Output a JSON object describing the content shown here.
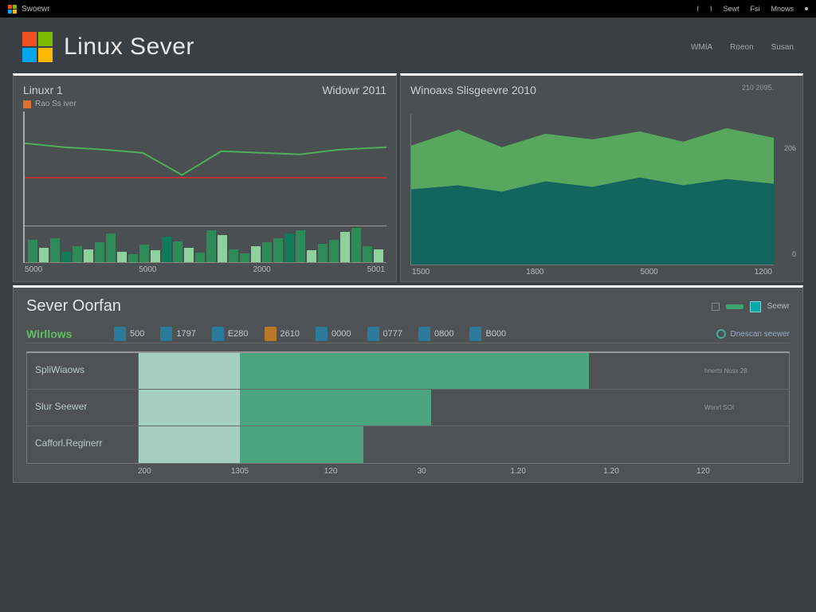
{
  "topbar": {
    "app_label": "Swoewr",
    "nav": [
      "I",
      "I",
      "Sewt",
      "Fsi",
      "Mnows",
      "I"
    ]
  },
  "header": {
    "title": "Linux Sever",
    "nav": [
      "WMIA",
      "Roeon",
      "Susan"
    ]
  },
  "panel_left": {
    "title_left": "Linuxr 1",
    "title_right": "Widowr 2011",
    "legend_label": "Rao Ss iver",
    "legend_color": "#e07030",
    "xaxis": [
      "5000",
      "5000",
      "2000",
      "5001"
    ]
  },
  "panel_right": {
    "title": "Winoaxs Slisgeevre 2010",
    "side_label_top": "206",
    "side_label_bottom": "0",
    "right_meta": [
      "210",
      "2095."
    ],
    "xaxis": [
      "1500",
      "1800",
      "5000",
      "1200"
    ]
  },
  "section": {
    "title": "Sever Oorfan",
    "toggle_label": "Seewr",
    "stat_label": "Wirllows",
    "stats": [
      "500",
      "1797",
      "E280",
      "2610",
      "0000",
      "0777",
      "0800",
      "B000"
    ],
    "end_label": "Dnescan seewer",
    "hbars": {
      "rows": [
        {
          "label": "SpliWiaows",
          "note": "hnerts Nosx 28"
        },
        {
          "label": "Slur Seewer",
          "note": "Wonrt SOI"
        },
        {
          "label": "Cafforl.Reginerr",
          "note": ""
        }
      ],
      "xaxis": [
        "200",
        "1305",
        "120",
        "30",
        "1.20",
        "1.20",
        "120"
      ]
    }
  },
  "chart_data": [
    {
      "type": "line",
      "title": "Linuxr 1 / Widowr 2011",
      "x": [
        0,
        1,
        2,
        3,
        4,
        5,
        6,
        7,
        8,
        9
      ],
      "series": [
        {
          "name": "green-line",
          "values": [
            150,
            145,
            142,
            138,
            110,
            140,
            138,
            136,
            142,
            145
          ]
        },
        {
          "name": "red-line",
          "values": [
            105,
            105,
            105,
            105,
            105,
            105,
            105,
            105,
            105,
            105
          ]
        }
      ],
      "bars": {
        "values": [
          28,
          18,
          30,
          12,
          20,
          16,
          25,
          36,
          14,
          10,
          22,
          15,
          32,
          26,
          18,
          12,
          40,
          34,
          16,
          11,
          20,
          25,
          30,
          36,
          40,
          15,
          24,
          28,
          38,
          44,
          20,
          16
        ]
      },
      "ylim": [
        0,
        190
      ]
    },
    {
      "type": "area",
      "title": "Winoaxs Slisgeevre 2010",
      "x": [
        0,
        1,
        2,
        3,
        4,
        5,
        6,
        7,
        8
      ],
      "series": [
        {
          "name": "dark",
          "values": [
            95,
            100,
            92,
            105,
            98,
            110,
            100,
            108,
            102
          ]
        },
        {
          "name": "light",
          "values": [
            150,
            170,
            148,
            165,
            158,
            168,
            155,
            172,
            160
          ]
        }
      ],
      "ylim": [
        0,
        206
      ]
    },
    {
      "type": "bar",
      "title": "Sever Oorfan",
      "orientation": "horizontal",
      "categories": [
        "SpliWiaows",
        "Slur Seewer",
        "Cafforl.Reginerr"
      ],
      "series": [
        {
          "name": "light",
          "values": [
            18,
            18,
            18
          ]
        },
        {
          "name": "dark",
          "values": [
            62,
            34,
            22
          ]
        }
      ],
      "xlim": [
        0,
        100
      ]
    }
  ]
}
